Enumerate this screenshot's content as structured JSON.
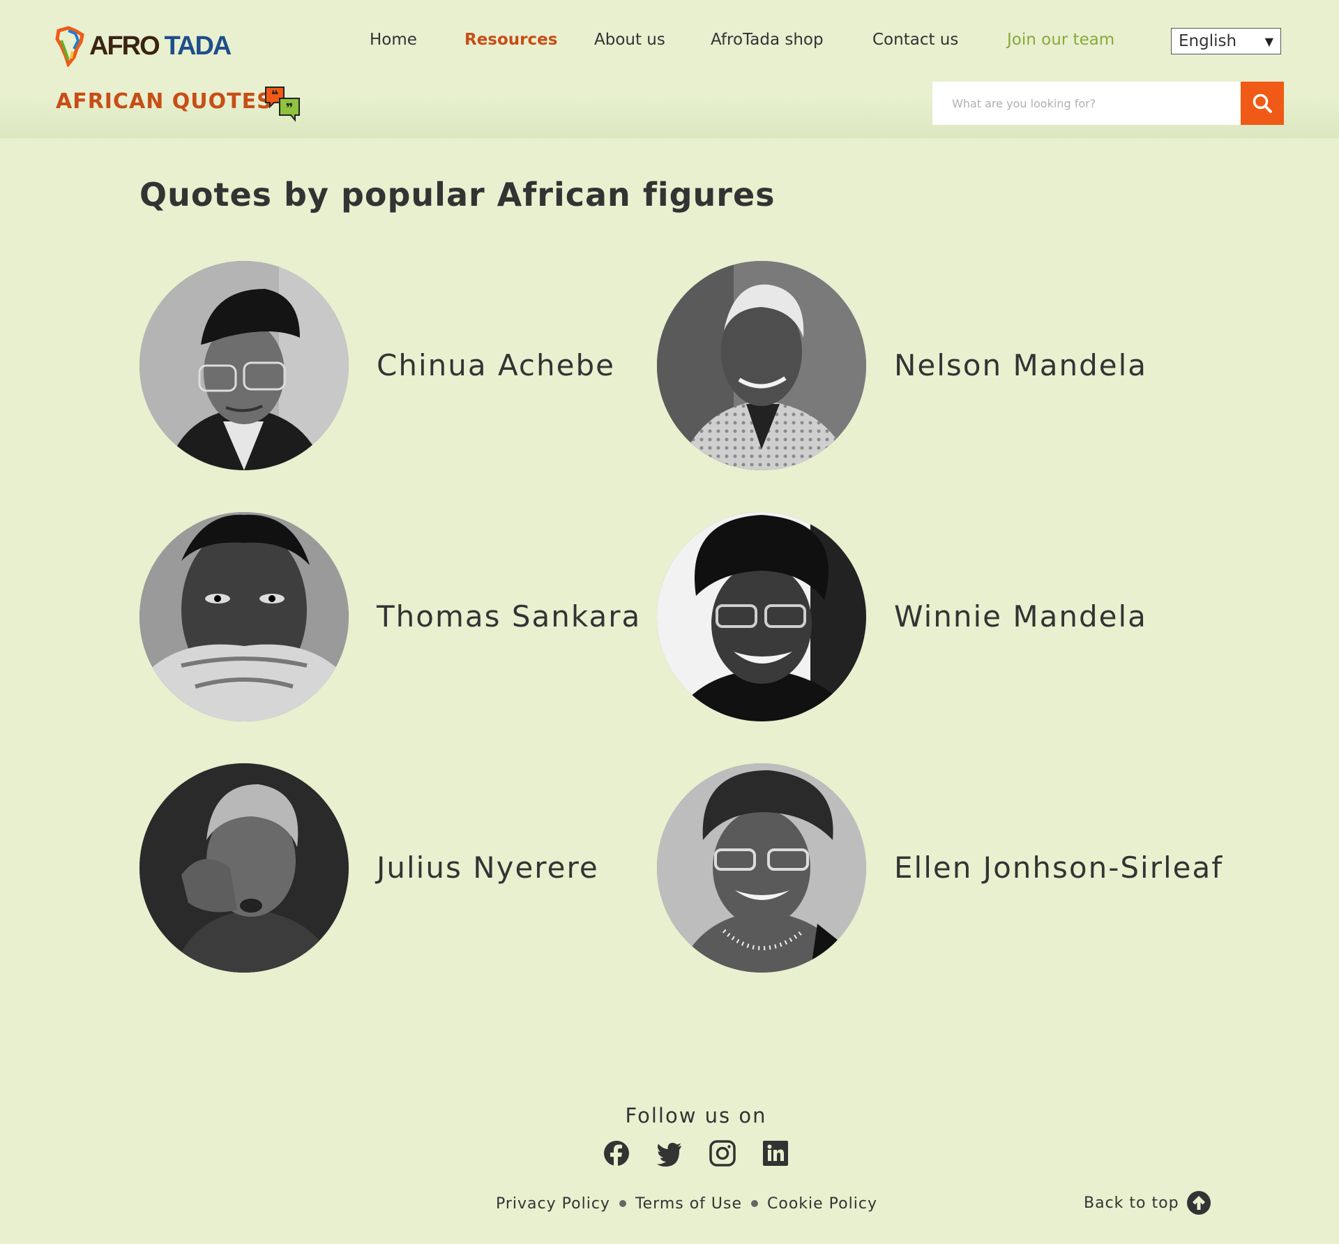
{
  "brand": {
    "logo_part1": "AFRO",
    "logo_part2": "TADA"
  },
  "nav": {
    "items": [
      {
        "label": "Home"
      },
      {
        "label": "Resources"
      },
      {
        "label": "About us"
      },
      {
        "label": "AfroTada shop"
      },
      {
        "label": "Contact us"
      },
      {
        "label": "Join our team"
      }
    ],
    "language": "English"
  },
  "section": {
    "title": "AFRICAN QUOTES",
    "icon": "quote-bubbles-icon"
  },
  "search": {
    "placeholder": "What are you looking for?",
    "icon": "search-icon"
  },
  "main": {
    "title": "Quotes by popular African figures",
    "figures": [
      {
        "name": "Chinua Achebe"
      },
      {
        "name": "Nelson Mandela"
      },
      {
        "name": "Thomas Sankara"
      },
      {
        "name": "Winnie Mandela"
      },
      {
        "name": "Julius Nyerere"
      },
      {
        "name": "Ellen Jonhson-Sirleaf"
      }
    ]
  },
  "footer": {
    "follow_title": "Follow us on",
    "social": [
      "facebook-icon",
      "twitter-icon",
      "instagram-icon",
      "linkedin-icon"
    ],
    "links": [
      "Privacy Policy",
      "Terms of Use",
      "Cookie Policy"
    ],
    "back_to_top": "Back to top"
  },
  "colors": {
    "background": "#e8f0d0",
    "accent_orange": "#f05a16",
    "active_nav": "#c84d16",
    "highlight_green": "#8aa83a",
    "text": "#333333"
  }
}
